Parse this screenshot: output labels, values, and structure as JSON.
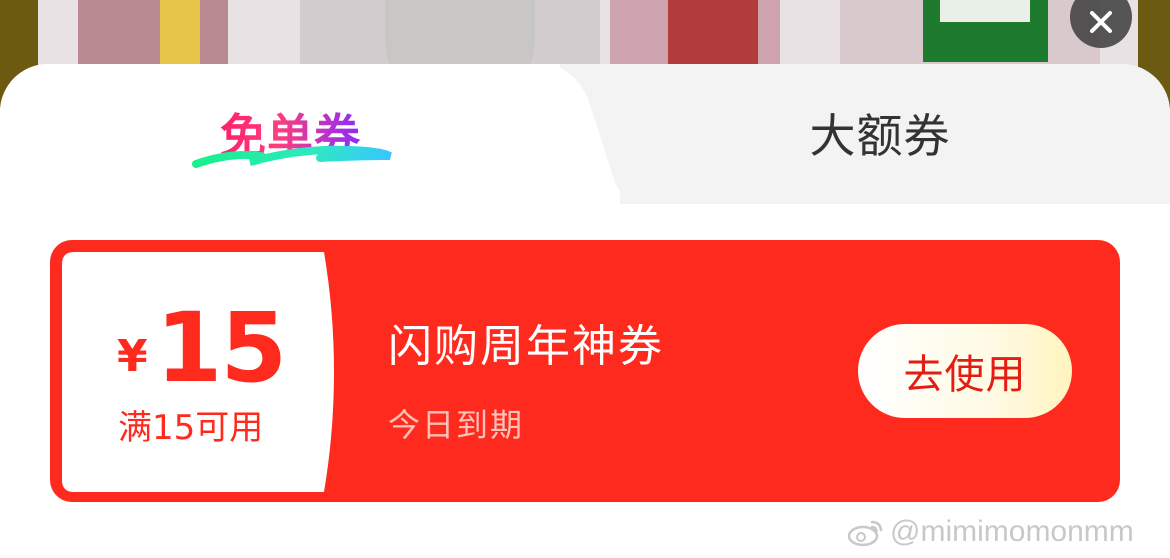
{
  "tabs": [
    {
      "label": "免单券",
      "active": true
    },
    {
      "label": "大额券",
      "active": false
    }
  ],
  "coupon": {
    "currency": "¥",
    "amount": "15",
    "threshold": "满15可用",
    "title": "闪购周年神券",
    "expiry": "今日到期",
    "action_label": "去使用"
  },
  "watermark": {
    "text": "@mimimomonmm"
  },
  "colors": {
    "coupon_red": "#ff2a1e",
    "tab_active_gradient_start": "#ff1f6f",
    "tab_active_underline": "#2ef0a0",
    "button_text": "#e41c12"
  },
  "icons": {
    "close": "close-icon",
    "watermark": "weibo-icon"
  }
}
